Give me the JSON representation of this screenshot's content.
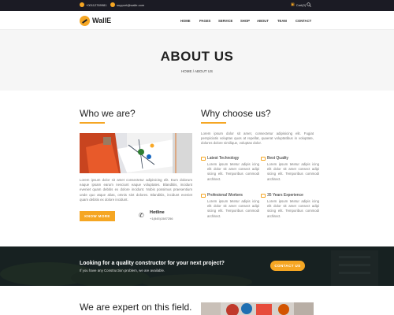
{
  "topbar": {
    "phone": "+00112789981",
    "email": "support@walle.com",
    "cart": "Cart(0)",
    "search_icon": "search-icon"
  },
  "header": {
    "logo_text": "WallE",
    "nav": [
      "HOME",
      "PAGES",
      "SERVICE",
      "SHOP",
      "ABOUT",
      "TEAM",
      "CONTACT"
    ]
  },
  "title_band": {
    "title": "ABOUT US",
    "breadcrumb": "HOME / ABOUT US"
  },
  "who": {
    "heading": "Who we are?",
    "text": "Lorem ipsum dolor sit amet consectetur adipisicing elit. Eum dolorum eaque ipsam earum nesciunt eaque voluptates. Blanditiis, incidunt eveniet quam debitis ex dolore incidunt. Nobis possimus praesentium unde quo atque alias, omnis sint dolores. Blanditiis, incidunt eveniet quam debitis ex dolore incidunt.",
    "button": "KNOW MORE",
    "hotline_label": "Hotline",
    "hotline_number": "+1(845)1587256"
  },
  "why": {
    "heading": "Why choose us?",
    "text": "Lorem ipsum dolor sit amet, consectetur adipisicing elit. Fugiat perspiciatis voluptas quos at repellat, quaerat voluptatibus in voluptate, dolores dolore similique, voluptas dolor.",
    "features": [
      {
        "title": "Latest Technology",
        "text": "Lorem ipsum tetetur adipis icing elit dolor sit amet consect adipi sicing elit. Temporibus commodi architect."
      },
      {
        "title": "Best Quality",
        "text": "Lorem ipsum tetetur adipis icing elit dolor sit amet consect adipi sicing elit. Temporibus commodi architect."
      },
      {
        "title": "Profesional Workers",
        "text": "Lorem ipsum tetetur adipis icing elit dolor sit amet consect adipi sicing elit. Temporibus commodi architect."
      },
      {
        "title": "35 Years Experience",
        "text": "Lorem ipsum tetetur adipis icing elit dolor sit amet consect adipi sicing elit. Temporibus commodi architect."
      }
    ]
  },
  "cta": {
    "title": "Looking for a quality constructor for your next project?",
    "subtitle": "If you have any Construction problem, we are available.",
    "button": "CONTACT US"
  },
  "expert": {
    "heading": "We are expert on this field."
  },
  "colors": {
    "accent": "#f5a623",
    "dark": "#1b1b24"
  }
}
